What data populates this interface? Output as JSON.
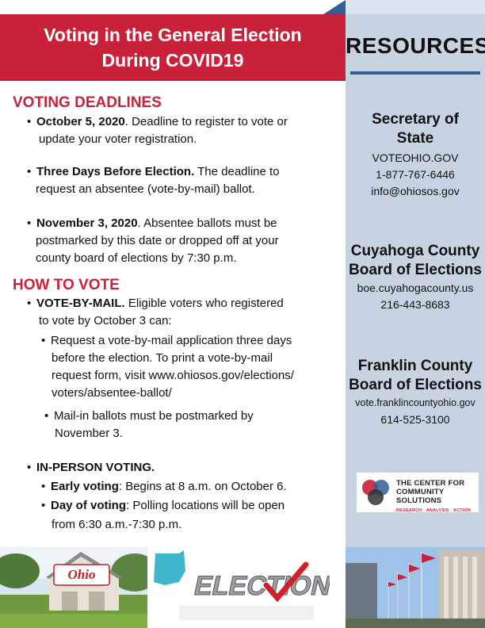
{
  "header": {
    "title_line1": "Voting in the General Election",
    "title_line2": "During COVID19"
  },
  "deadlines": {
    "heading": "VOTING DEADLINES",
    "items": [
      {
        "bold": "October 5, 2020",
        "rest_line1": ". Deadline to register to vote or",
        "line2": "update your voter registration."
      },
      {
        "bold": "Three Days Before Election.",
        "rest_line1": " The deadline to",
        "line2": "request an absentee (vote-by-mail) ballot."
      },
      {
        "bold": "November 3, 2020",
        "rest_line1": ". Absentee ballots must be",
        "line2": "postmarked by this date or dropped off at your",
        "line3": "county board of elections by 7:30 p.m."
      }
    ]
  },
  "how_to_vote": {
    "heading": "HOW TO VOTE",
    "vbm": {
      "bold": "VOTE-BY-MAIL.",
      "rest_line1": " Eligible voters who registered",
      "line2": "to vote by October 3 can:",
      "sub1": [
        "Request a vote-by-mail application three days",
        "before the election. To print a vote-by-mail",
        "request form, visit www.ohiosos.gov/elections/",
        "voters/absentee-ballot/"
      ],
      "sub2": [
        "Mail-in ballots must be postmarked by",
        "November 3."
      ]
    },
    "inperson": {
      "bold": "IN-PERSON VOTING.",
      "early_bold": "Early voting",
      "early_rest": ": Begins at 8 a.m. on October 6.",
      "day_bold": "Day of voting",
      "day_rest": ": Polling locations will be open",
      "day_line2": "from 6:30 a.m.-7:30 p.m."
    }
  },
  "resources": {
    "title": "RESOURCES",
    "sos": {
      "name1": "Secretary of",
      "name2": "State",
      "site": "VOTEOHIO.GOV",
      "phone": "1-877-767-6446",
      "email": "info@ohiosos.gov"
    },
    "cuyahoga": {
      "name1": "Cuyahoga County",
      "name2": "Board of Elections",
      "site": "boe.cuyahogacounty.us",
      "phone": "216-443-8683"
    },
    "franklin": {
      "name1": "Franklin County",
      "name2": "Board of Elections",
      "site": "vote.franklincountyohio.gov",
      "phone": "614-525-3100"
    }
  },
  "logo": {
    "line1": "THE CENTER FOR",
    "line2": "COMMUNITY SOLUTIONS",
    "tagline": "RESEARCH · ANALYSIS · ACTION"
  },
  "images": {
    "barn_text": "Ohio",
    "election_text": "ELECTION"
  },
  "colors": {
    "accent": "#c8213a",
    "sidebar": "#c8d3e2",
    "rule": "#2f5f96"
  }
}
